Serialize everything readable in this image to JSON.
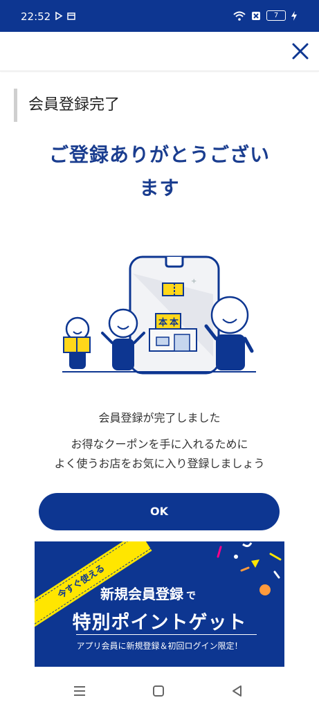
{
  "status": {
    "time": "22:52",
    "battery": "7"
  },
  "page": {
    "section_title": "会員登録完了",
    "headline_line1": "ご登録ありがとうござい",
    "headline_line2": "ます",
    "message1": "会員登録が完了しました",
    "message2_line1": "お得なクーポンを手に入れるために",
    "message2_line2": "よく使うお店をお気に入り登録しましょう",
    "ok_label": "OK"
  },
  "illustration": {
    "store_sign": "本"
  },
  "banner": {
    "ribbon": "今すぐ使える",
    "line1": "新規会員登録",
    "line1_suffix": "で",
    "line2": "特別ポイントゲット",
    "line3": "アプリ会員に新規登録＆初回ログイン限定！"
  },
  "colors": {
    "brand": "#0d3691",
    "accent": "#ffe600"
  },
  "icons": [
    "play-icon",
    "calendar-icon",
    "wifi-icon",
    "sim-icon",
    "charging-icon",
    "close-icon",
    "menu-icon",
    "home-icon",
    "back-icon"
  ]
}
